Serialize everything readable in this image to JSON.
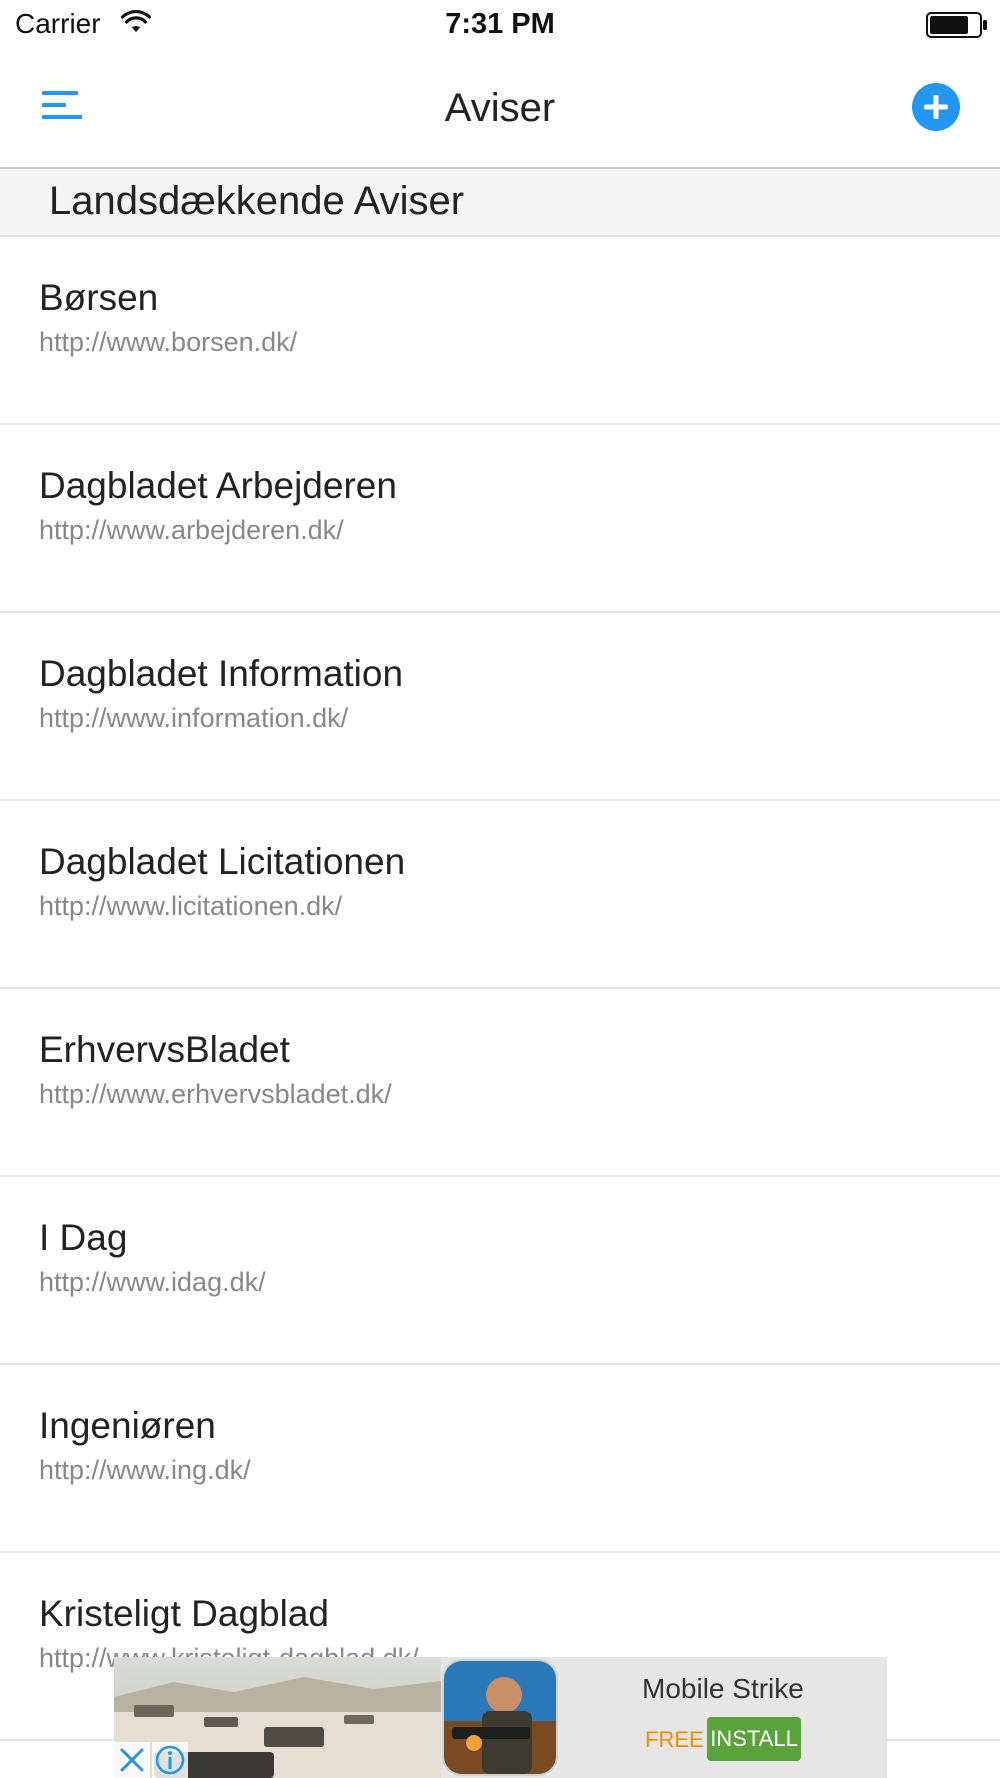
{
  "status_bar": {
    "carrier": "Carrier",
    "time": "7:31 PM"
  },
  "nav": {
    "title": "Aviser",
    "menu_icon": "hamburger-menu-icon",
    "add_icon": "plus-circle-icon"
  },
  "section": {
    "title": "Landsdækkende Aviser"
  },
  "newspapers": [
    {
      "name": "Børsen",
      "url": "http://www.borsen.dk/"
    },
    {
      "name": "Dagbladet Arbejderen",
      "url": "http://www.arbejderen.dk/"
    },
    {
      "name": "Dagbladet Information",
      "url": "http://www.information.dk/"
    },
    {
      "name": "Dagbladet Licitationen",
      "url": "http://www.licitationen.dk/"
    },
    {
      "name": "ErhvervsBladet",
      "url": "http://www.erhvervsbladet.dk/"
    },
    {
      "name": "I Dag",
      "url": "http://www.idag.dk/"
    },
    {
      "name": "Ingeniøren",
      "url": "http://www.ing.dk/"
    },
    {
      "name": "Kristeligt Dagblad",
      "url": "http://www.kristeligt-dagblad.dk/"
    }
  ],
  "ad": {
    "title": "Mobile Strike",
    "price": "FREE",
    "install_label": "INSTALL"
  },
  "colors": {
    "accent": "#2196f3",
    "install_green": "#5aa33a",
    "free_orange": "#f28c00"
  }
}
